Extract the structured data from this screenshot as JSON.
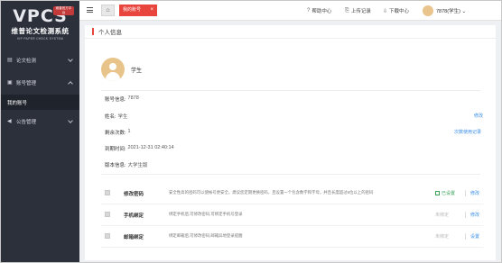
{
  "logo": {
    "word": "VPCS",
    "badge": "维普官方平台",
    "cn": "维普论文检测系统",
    "en": "VIP PAPER CHECK SYSTEM"
  },
  "sidebar": {
    "items": [
      {
        "label": "论文检测",
        "icon": "document-icon"
      },
      {
        "label": "账号管理",
        "icon": "account-icon"
      },
      {
        "label": "我的账号",
        "icon": ""
      },
      {
        "label": "公告管理",
        "icon": "megaphone-icon"
      }
    ]
  },
  "topbar": {
    "home_glyph": "⌂",
    "active_tab": "我的账号",
    "close_glyph": "×",
    "help": "帮助中心",
    "upload_log": "上传记录",
    "download": "下载中心",
    "user": "7878(学生)"
  },
  "page": {
    "title": "个人信息",
    "profile_name": "学生",
    "rows": [
      {
        "label": "账号信息:",
        "value": "7878"
      },
      {
        "label": "姓名:",
        "value": "学生",
        "link": "修改"
      },
      {
        "label": "剩余次数:",
        "value": "1",
        "link": "次数使用记录"
      },
      {
        "label": "到期时间:",
        "value": "2021-12-31 02:40:14"
      },
      {
        "label": "版本信息:",
        "value": "大学生版"
      }
    ]
  },
  "security": [
    {
      "title": "修改密码",
      "desc": "安全性高的密码可以使帐号更安全。建议您定期更换密码，且设置一个包含数字和字母，并且长度超过6位以上的密码",
      "status": "已设置",
      "action": "修改",
      "set": true
    },
    {
      "title": "手机绑定",
      "desc": "绑定手机后,可修改密码,可绑定手机号登录",
      "status": "未绑定",
      "action": "修改",
      "set": false
    },
    {
      "title": "邮箱绑定",
      "desc": "绑定邮箱后,可修改密码,邮箱异地登录提醒",
      "status": "未绑定",
      "action": "设置",
      "set": false
    }
  ],
  "colors": {
    "accent": "#e8453c",
    "sidebar": "#2b303b",
    "link": "#3a8ee6",
    "ok": "#3aa55a"
  }
}
